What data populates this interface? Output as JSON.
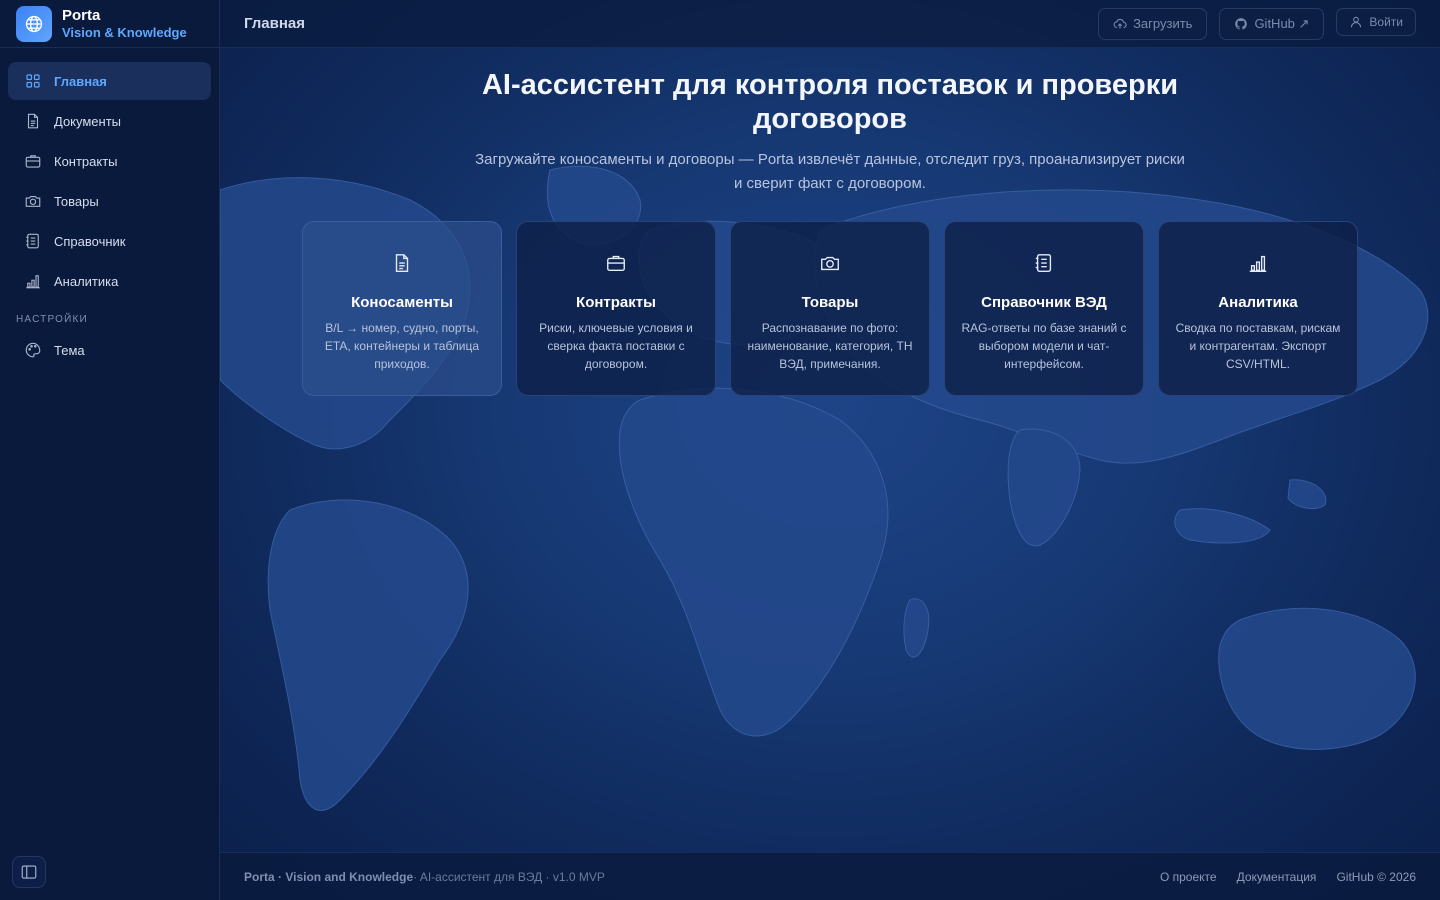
{
  "brand": {
    "title": "Porta",
    "subtitle": "Vision & Knowledge"
  },
  "sidebar": {
    "items": [
      {
        "label": "Главная",
        "icon": "grid-icon",
        "active": true
      },
      {
        "label": "Документы",
        "icon": "document-icon"
      },
      {
        "label": "Контракты",
        "icon": "briefcase-icon"
      },
      {
        "label": "Товары",
        "icon": "camera-icon"
      },
      {
        "label": "Справочник",
        "icon": "notebook-icon"
      },
      {
        "label": "Аналитика",
        "icon": "bar-chart-icon"
      }
    ],
    "section_label": "НАСТРОЙКИ",
    "settings_items": [
      {
        "label": "Тема",
        "icon": "palette-icon"
      }
    ]
  },
  "topbar": {
    "title": "Главная",
    "upload_label": "Загрузить",
    "github_label": "GitHub ↗",
    "login_label": "Войти"
  },
  "hero": {
    "title": "AI-ассистент для контроля поставок и проверки договоров",
    "subtitle": "Загружайте коносаменты и договоры — Porta извлечёт данные, отследит груз, проанализирует риски и сверит факт с договором."
  },
  "cards": [
    {
      "title": "Коносаменты",
      "desc": "B/L → номер, судно, порты, ETA, контейнеры и таблица приходов.",
      "icon": "document-icon"
    },
    {
      "title": "Контракты",
      "desc": "Риски, ключевые условия и сверка факта поставки с договором.",
      "icon": "briefcase-icon"
    },
    {
      "title": "Товары",
      "desc": "Распознавание по фото: наименование, категория, ТН ВЭД, примечания.",
      "icon": "camera-icon"
    },
    {
      "title": "Справочник ВЭД",
      "desc": "RAG-ответы по базе знаний с выбором модели и чат-интерфейсом.",
      "icon": "notebook-icon"
    },
    {
      "title": "Аналитика",
      "desc": "Сводка по поставкам, рискам и контрагентам. Экспорт CSV/HTML.",
      "icon": "bar-chart-icon"
    }
  ],
  "footer": {
    "brand": "Porta · Vision and Knowledge",
    "tagline": " · AI-ассистент для ВЭД · v1.0 MVP",
    "about": "О проекте",
    "docs": "Документация",
    "github": "GitHub © 2026"
  },
  "colors": {
    "accent": "#5ea8ff",
    "sidebar_bg": "#0a1a3d",
    "card_bg": "#0e2048"
  }
}
